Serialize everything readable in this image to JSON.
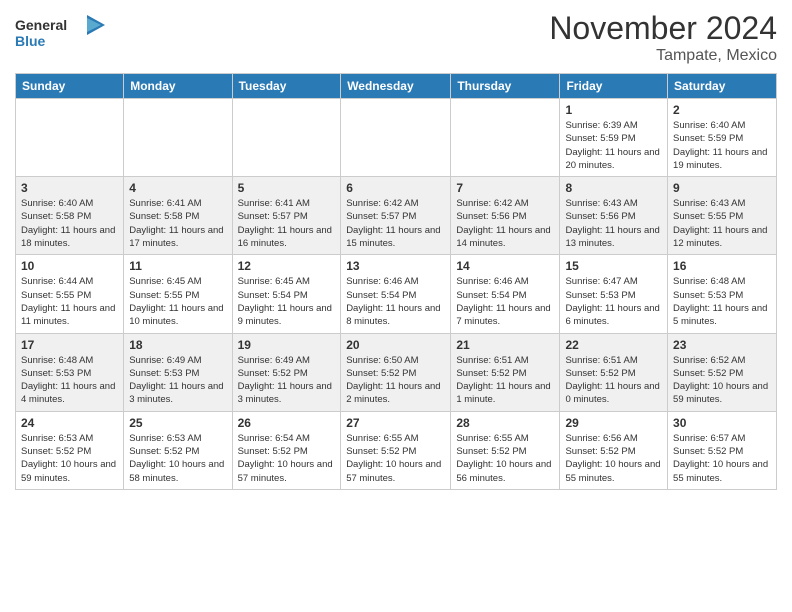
{
  "header": {
    "logo_general": "General",
    "logo_blue": "Blue",
    "month_title": "November 2024",
    "location": "Tampate, Mexico"
  },
  "calendar": {
    "days_of_week": [
      "Sunday",
      "Monday",
      "Tuesday",
      "Wednesday",
      "Thursday",
      "Friday",
      "Saturday"
    ],
    "weeks": [
      [
        {
          "day": "",
          "info": ""
        },
        {
          "day": "",
          "info": ""
        },
        {
          "day": "",
          "info": ""
        },
        {
          "day": "",
          "info": ""
        },
        {
          "day": "",
          "info": ""
        },
        {
          "day": "1",
          "info": "Sunrise: 6:39 AM\nSunset: 5:59 PM\nDaylight: 11 hours and 20 minutes."
        },
        {
          "day": "2",
          "info": "Sunrise: 6:40 AM\nSunset: 5:59 PM\nDaylight: 11 hours and 19 minutes."
        }
      ],
      [
        {
          "day": "3",
          "info": "Sunrise: 6:40 AM\nSunset: 5:58 PM\nDaylight: 11 hours and 18 minutes."
        },
        {
          "day": "4",
          "info": "Sunrise: 6:41 AM\nSunset: 5:58 PM\nDaylight: 11 hours and 17 minutes."
        },
        {
          "day": "5",
          "info": "Sunrise: 6:41 AM\nSunset: 5:57 PM\nDaylight: 11 hours and 16 minutes."
        },
        {
          "day": "6",
          "info": "Sunrise: 6:42 AM\nSunset: 5:57 PM\nDaylight: 11 hours and 15 minutes."
        },
        {
          "day": "7",
          "info": "Sunrise: 6:42 AM\nSunset: 5:56 PM\nDaylight: 11 hours and 14 minutes."
        },
        {
          "day": "8",
          "info": "Sunrise: 6:43 AM\nSunset: 5:56 PM\nDaylight: 11 hours and 13 minutes."
        },
        {
          "day": "9",
          "info": "Sunrise: 6:43 AM\nSunset: 5:55 PM\nDaylight: 11 hours and 12 minutes."
        }
      ],
      [
        {
          "day": "10",
          "info": "Sunrise: 6:44 AM\nSunset: 5:55 PM\nDaylight: 11 hours and 11 minutes."
        },
        {
          "day": "11",
          "info": "Sunrise: 6:45 AM\nSunset: 5:55 PM\nDaylight: 11 hours and 10 minutes."
        },
        {
          "day": "12",
          "info": "Sunrise: 6:45 AM\nSunset: 5:54 PM\nDaylight: 11 hours and 9 minutes."
        },
        {
          "day": "13",
          "info": "Sunrise: 6:46 AM\nSunset: 5:54 PM\nDaylight: 11 hours and 8 minutes."
        },
        {
          "day": "14",
          "info": "Sunrise: 6:46 AM\nSunset: 5:54 PM\nDaylight: 11 hours and 7 minutes."
        },
        {
          "day": "15",
          "info": "Sunrise: 6:47 AM\nSunset: 5:53 PM\nDaylight: 11 hours and 6 minutes."
        },
        {
          "day": "16",
          "info": "Sunrise: 6:48 AM\nSunset: 5:53 PM\nDaylight: 11 hours and 5 minutes."
        }
      ],
      [
        {
          "day": "17",
          "info": "Sunrise: 6:48 AM\nSunset: 5:53 PM\nDaylight: 11 hours and 4 minutes."
        },
        {
          "day": "18",
          "info": "Sunrise: 6:49 AM\nSunset: 5:53 PM\nDaylight: 11 hours and 3 minutes."
        },
        {
          "day": "19",
          "info": "Sunrise: 6:49 AM\nSunset: 5:52 PM\nDaylight: 11 hours and 3 minutes."
        },
        {
          "day": "20",
          "info": "Sunrise: 6:50 AM\nSunset: 5:52 PM\nDaylight: 11 hours and 2 minutes."
        },
        {
          "day": "21",
          "info": "Sunrise: 6:51 AM\nSunset: 5:52 PM\nDaylight: 11 hours and 1 minute."
        },
        {
          "day": "22",
          "info": "Sunrise: 6:51 AM\nSunset: 5:52 PM\nDaylight: 11 hours and 0 minutes."
        },
        {
          "day": "23",
          "info": "Sunrise: 6:52 AM\nSunset: 5:52 PM\nDaylight: 10 hours and 59 minutes."
        }
      ],
      [
        {
          "day": "24",
          "info": "Sunrise: 6:53 AM\nSunset: 5:52 PM\nDaylight: 10 hours and 59 minutes."
        },
        {
          "day": "25",
          "info": "Sunrise: 6:53 AM\nSunset: 5:52 PM\nDaylight: 10 hours and 58 minutes."
        },
        {
          "day": "26",
          "info": "Sunrise: 6:54 AM\nSunset: 5:52 PM\nDaylight: 10 hours and 57 minutes."
        },
        {
          "day": "27",
          "info": "Sunrise: 6:55 AM\nSunset: 5:52 PM\nDaylight: 10 hours and 57 minutes."
        },
        {
          "day": "28",
          "info": "Sunrise: 6:55 AM\nSunset: 5:52 PM\nDaylight: 10 hours and 56 minutes."
        },
        {
          "day": "29",
          "info": "Sunrise: 6:56 AM\nSunset: 5:52 PM\nDaylight: 10 hours and 55 minutes."
        },
        {
          "day": "30",
          "info": "Sunrise: 6:57 AM\nSunset: 5:52 PM\nDaylight: 10 hours and 55 minutes."
        }
      ]
    ]
  }
}
